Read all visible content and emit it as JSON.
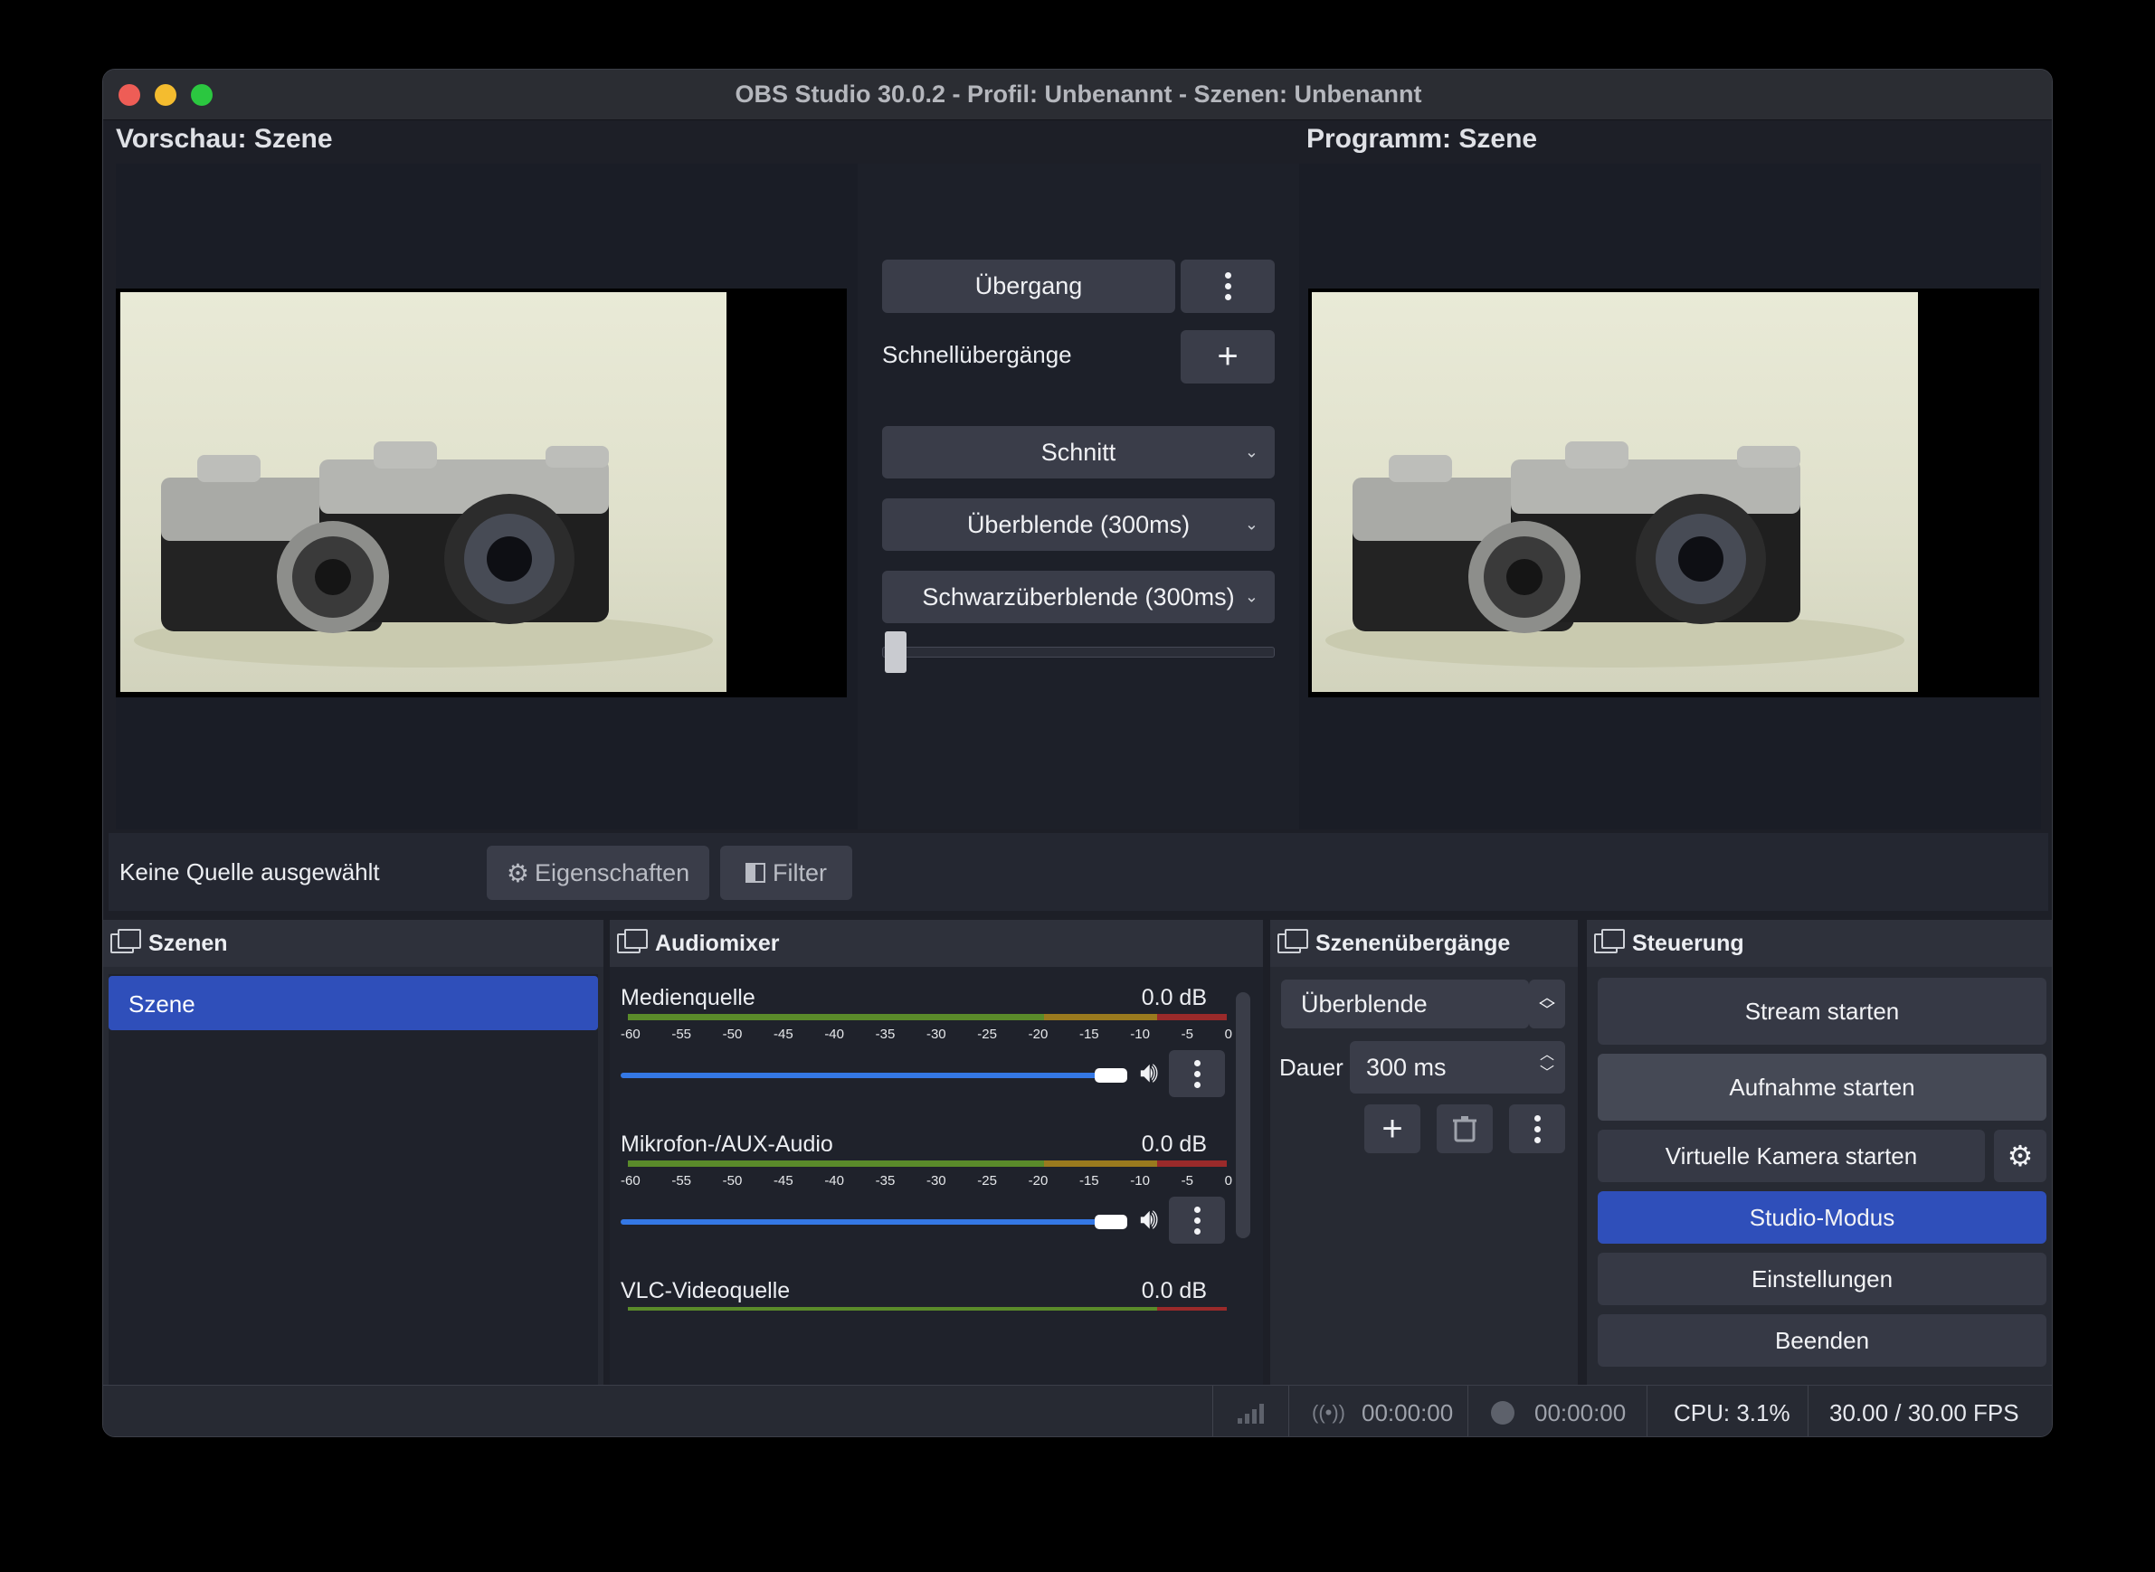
{
  "window": {
    "title": "OBS Studio 30.0.2 - Profil: Unbenannt - Szenen: Unbenannt"
  },
  "preview": {
    "label": "Vorschau: Szene"
  },
  "program": {
    "label": "Programm: Szene"
  },
  "transitions_center": {
    "transition_button": "Übergang",
    "quick_label": "Schnellübergänge",
    "quick": [
      "Schnitt",
      "Überblende (300ms)",
      "Schwarzüberblende (300ms)"
    ],
    "tbar_value": 0
  },
  "sourcebar": {
    "no_source": "Keine Quelle ausgewählt",
    "properties": "Eigenschaften",
    "filter": "Filter"
  },
  "scenes": {
    "title": "Szenen",
    "items": [
      "Szene"
    ],
    "selected": "Szene"
  },
  "audiomixer": {
    "title": "Audiomixer",
    "scale": [
      "-60",
      "-55",
      "-50",
      "-45",
      "-40",
      "-35",
      "-30",
      "-25",
      "-20",
      "-15",
      "-10",
      "-5",
      "0"
    ],
    "channels": [
      {
        "name": "Medienquelle",
        "db": "0.0 dB",
        "volume": 1.0
      },
      {
        "name": "Mikrofon-/AUX-Audio",
        "db": "0.0 dB",
        "volume": 1.0
      },
      {
        "name": "VLC-Videoquelle",
        "db": "0.0 dB",
        "volume": 1.0
      }
    ]
  },
  "scene_transitions": {
    "title": "Szenenübergänge",
    "selected": "Überblende",
    "duration_label": "Dauer",
    "duration_value": "300 ms"
  },
  "controls": {
    "title": "Steuerung",
    "stream": "Stream starten",
    "record": "Aufnahme starten",
    "virtualcam": "Virtuelle Kamera starten",
    "studio_mode": "Studio-Modus",
    "settings": "Einstellungen",
    "exit": "Beenden"
  },
  "status": {
    "stream_time": "00:00:00",
    "record_time": "00:00:00",
    "cpu": "CPU: 3.1%",
    "fps": "30.00 / 30.00 FPS"
  },
  "colors": {
    "accent": "#2f4fba",
    "meter_green": "#5a8b2a",
    "meter_yellow": "#9a7a1e",
    "meter_red": "#9a2a2a",
    "slider": "#3478e5"
  },
  "icons": {
    "plus": "plus-icon",
    "trash": "trash-icon",
    "filter": "filter-icon",
    "up": "chevron-up-icon",
    "down": "chevron-down-icon",
    "gear": "gear-icon",
    "speaker": "speaker-icon",
    "menu": "kebab-menu-icon"
  }
}
